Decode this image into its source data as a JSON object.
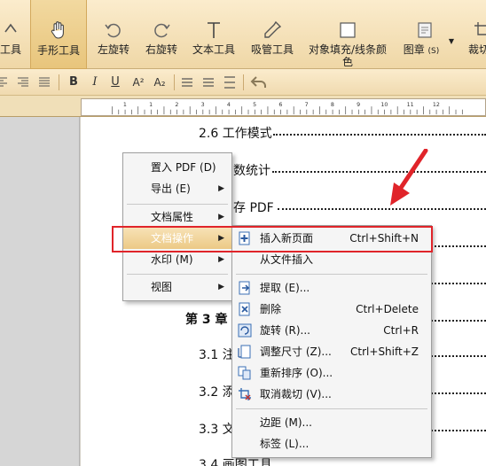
{
  "toolbar": {
    "partial_left": "工具",
    "hand": "手形工具",
    "rotate_left": "左旋转",
    "rotate_right": "右旋转",
    "text_tool": "文本工具",
    "eyedropper": "吸管工具",
    "fill_color": "对象填充/线条颜色",
    "stamp": "图章",
    "stamp_key": "(S)",
    "partial_right": "裁切"
  },
  "format_bar": {
    "bold": "B",
    "italic": "I",
    "underline": "U",
    "superscript": "A²",
    "subscript": "A₂"
  },
  "ruler_labels": [
    "1",
    "1",
    "2",
    "3",
    "4",
    "5",
    "6",
    "7",
    "8",
    "9",
    "10",
    "11",
    "12"
  ],
  "document": {
    "lines": [
      "2.6 工作模式",
      "数统计",
      "存 PDF",
      "第 3 章",
      "3.1 注",
      "3.2 添",
      "3.3 文",
      "3.4 画图工具"
    ]
  },
  "context_menu": {
    "items": [
      {
        "label": "置入 PDF (D)"
      },
      {
        "label": "导出 (E)",
        "submenu": true
      },
      {
        "label": "文档属性",
        "submenu": true
      },
      {
        "label": "文档操作",
        "submenu": true,
        "highlighted": true
      },
      {
        "label": "水印 (M)",
        "submenu": true
      },
      {
        "label": "视图",
        "submenu": true
      }
    ]
  },
  "submenu": {
    "items": [
      {
        "label": "插入新页面",
        "shortcut": "Ctrl+Shift+N",
        "icon": "insert-page-icon"
      },
      {
        "label": "从文件插入",
        "shortcut": ""
      },
      {
        "label": "提取 (E)...",
        "shortcut": "",
        "icon": "extract-icon"
      },
      {
        "label": "删除",
        "shortcut": "Ctrl+Delete",
        "icon": "delete-icon"
      },
      {
        "label": "旋转 (R)...",
        "shortcut": "Ctrl+R",
        "icon": "rotate-icon"
      },
      {
        "label": "调整尺寸 (Z)...",
        "shortcut": "Ctrl+Shift+Z",
        "icon": "resize-icon"
      },
      {
        "label": "重新排序 (O)...",
        "shortcut": "",
        "icon": "reorder-icon"
      },
      {
        "label": "取消裁切 (V)...",
        "shortcut": "",
        "icon": "uncrop-icon"
      },
      {
        "label": "边距 (M)...",
        "shortcut": ""
      },
      {
        "label": "标签 (L)...",
        "shortcut": ""
      }
    ]
  },
  "colors": {
    "highlight_box": "#e0242a",
    "arrow": "#e0242a",
    "toolbar_bg": "#f5e2b8"
  }
}
